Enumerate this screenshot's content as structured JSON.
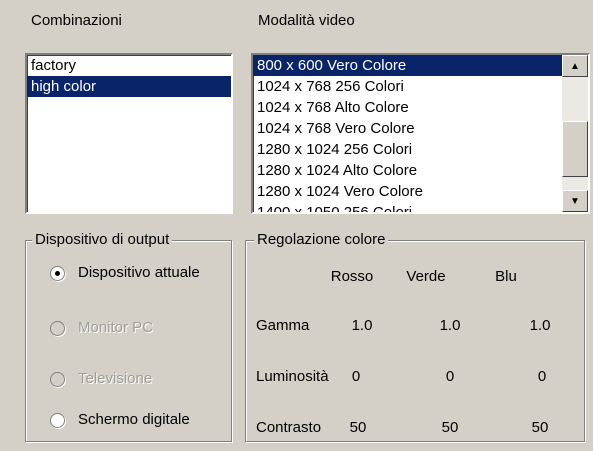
{
  "combinazioni": {
    "label": "Combinazioni",
    "items": [
      {
        "label": "factory",
        "selected": false
      },
      {
        "label": "high color",
        "selected": true
      }
    ]
  },
  "video": {
    "label": "Modalità video",
    "items": [
      {
        "label": "800 x 600 Vero Colore",
        "selected": true
      },
      {
        "label": "1024 x 768 256 Colori",
        "selected": false
      },
      {
        "label": "1024 x 768 Alto Colore",
        "selected": false
      },
      {
        "label": "1024 x 768 Vero Colore",
        "selected": false
      },
      {
        "label": "1280 x 1024 256 Colori",
        "selected": false
      },
      {
        "label": "1280 x 1024 Alto Colore",
        "selected": false
      },
      {
        "label": "1280 x 1024 Vero Colore",
        "selected": false
      },
      {
        "label": "1400 x 1050 256 Colori",
        "selected": false
      }
    ],
    "scroll_up_icon": "up-arrow-icon",
    "scroll_down_icon": "down-arrow-icon"
  },
  "output": {
    "title": "Dispositivo di output",
    "options": [
      {
        "label": "Dispositivo attuale",
        "checked": true,
        "enabled": true
      },
      {
        "label": "Monitor PC",
        "checked": false,
        "enabled": false
      },
      {
        "label": "Televisione",
        "checked": false,
        "enabled": false
      },
      {
        "label": "Schermo digitale",
        "checked": false,
        "enabled": true
      }
    ]
  },
  "color": {
    "title": "Regolazione colore",
    "headers": [
      "Rosso",
      "Verde",
      "Blu"
    ],
    "rows": [
      {
        "label": "Gamma",
        "values": [
          "1.0",
          "1.0",
          "1.0"
        ]
      },
      {
        "label": "Luminosità",
        "values": [
          "0",
          "0",
          "0"
        ]
      },
      {
        "label": "Contrasto",
        "values": [
          "50",
          "50",
          "50"
        ]
      }
    ]
  },
  "colors": {
    "selection": "#0a246a",
    "face": "#d4d0c8",
    "disabled_text": "#a09d97"
  }
}
